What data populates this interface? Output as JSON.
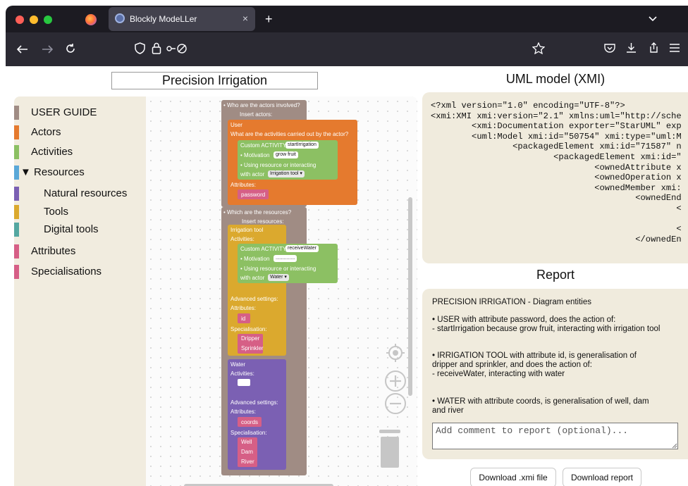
{
  "browser": {
    "tab_title": "Blockly ModeLLer",
    "new_tab": "+",
    "close_tab": "×"
  },
  "page": {
    "project_name": "Precision Irrigation",
    "xmi_title": "UML model (XMI)",
    "report_title": "Report"
  },
  "toolbox": [
    {
      "label": "USER GUIDE",
      "color": "#a08c84"
    },
    {
      "label": "Actors",
      "color": "#e57a2e"
    },
    {
      "label": "Activities",
      "color": "#8cc063"
    },
    {
      "label": "▼ Resources",
      "color": "#5ba8d8"
    },
    {
      "label": "Natural resources",
      "color": "#7b60b3"
    },
    {
      "label": "Tools",
      "color": "#dba92e"
    },
    {
      "label": "Digital tools",
      "color": "#55a7a1"
    },
    {
      "label": "Attributes",
      "color": "#d65f86"
    },
    {
      "label": "Specialisations",
      "color": "#d65f86"
    }
  ],
  "blocks": {
    "actors_q": "• Who are the actors involved?",
    "insert_actors": "Insert actors:",
    "actor_name": "User",
    "activities_q": "What are the activities carried out by the actor?",
    "custom_activity": "Custom ACTIVITY:",
    "activity1": "startIrrigation",
    "motivation": "• Motivation",
    "motivation1": "grow fruit",
    "using": "• Using resource or interacting",
    "with_actor": "with actor",
    "actor1": "Irrigation tool ▾",
    "attributes": "Attributes:",
    "attr_password": "password",
    "resources_q": "• Which are the resources?",
    "insert_resources": "Insert resources:",
    "tool_name": "Irrigation tool",
    "activities": "Activities:",
    "activity2": "receiveWater",
    "motivation2": "..............",
    "actor2": "Water ▾",
    "advanced": "Advanced settings:",
    "attr_id": "id",
    "specialisation": "Specialisation:",
    "spec_dripper": "Dripper",
    "spec_sprinkler": "Sprinkler",
    "water_name": "Water",
    "attr_coords": "coords",
    "spec_well": "Well",
    "spec_dam": "Dam",
    "spec_river": "River"
  },
  "xmi_lines": [
    "<?xml version=\"1.0\" encoding=\"UTF-8\"?>",
    "<xmi:XMI xmi:version=\"2.1\" xmlns:uml=\"http://sche",
    "        <xmi:Documentation exporter=\"StarUML\" exp",
    "        <uml:Model xmi:id=\"50754\" xmi:type=\"uml:M",
    "                <packagedElement xmi:id=\"71587\" n",
    "                        <packagedElement xmi:id=\"",
    "                                <ownedAttribute x",
    "                                <ownedOperation x",
    "                                <ownedMember xmi:",
    "                                        <ownedEnd",
    "                                                <",
    "",
    "                                                <",
    "                                        </ownedEn"
  ],
  "report": {
    "heading": "PRECISION IRRIGATION - Diagram entities",
    "user_1": "• USER with attribute password, does the action of:",
    "user_2": "- startIrrigation because grow fruit, interacting with irrigation tool",
    "tool_1": "• IRRIGATION TOOL with attribute id, is generalisation of",
    "tool_2": "dripper and sprinkler, and does the action of:",
    "tool_3": "- receiveWater, interacting with water",
    "water_1": "• WATER with attribute coords, is generalisation of well, dam",
    "water_2": "and river",
    "comment_placeholder": "Add comment to report (optional)..."
  },
  "buttons": {
    "download_xmi": "Download .xmi file",
    "download_report": "Download report"
  }
}
